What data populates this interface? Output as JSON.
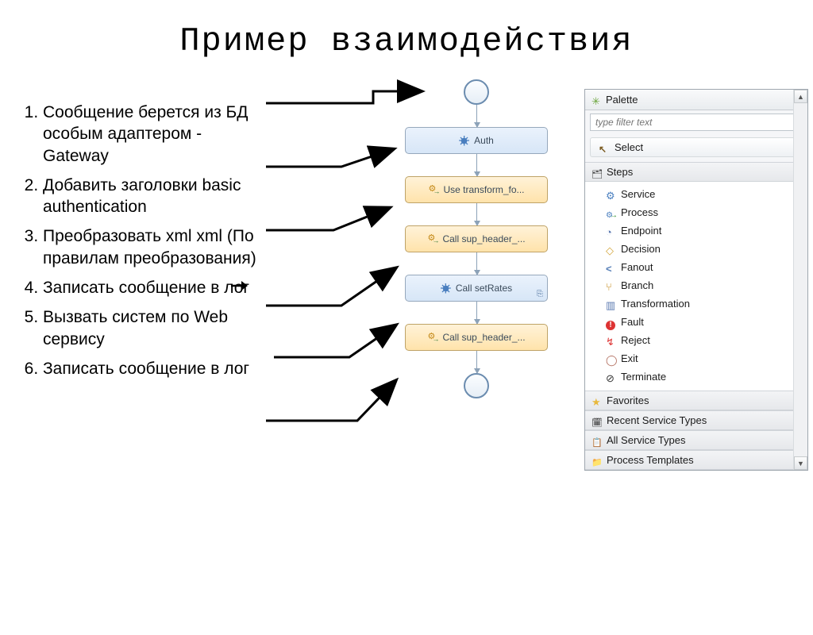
{
  "title": "Пример взаимодействия",
  "list": {
    "items": [
      "Сообщение берется из БД особым адаптером - Gateway",
      "Добавить заголовки basic authentication",
      "Преобразовать xml       xml (По правилам преобразования)",
      "Записать сообщение в лог",
      "Вызвать систем по Web сервису",
      "Записать сообщение в лог"
    ]
  },
  "flow": {
    "nodes": [
      {
        "label": "Auth",
        "icon": "gear",
        "selected": false
      },
      {
        "label": "Use transform_fo...",
        "icon": "pcog",
        "selected": true
      },
      {
        "label": "Call sup_header_...",
        "icon": "pcog",
        "selected": true
      },
      {
        "label": "Call setRates",
        "icon": "gear",
        "selected": false,
        "badge": "📋"
      },
      {
        "label": "Call sup_header_...",
        "icon": "pcog",
        "selected": true
      }
    ]
  },
  "palette": {
    "title": "Palette",
    "filter_placeholder": "type filter text",
    "select_label": "Select",
    "section": "Steps",
    "items": [
      {
        "icon": "ic-service",
        "label": "Service"
      },
      {
        "icon": "ic-process",
        "label": "Process"
      },
      {
        "icon": "ic-endpoint",
        "label": "Endpoint"
      },
      {
        "icon": "ic-decision",
        "label": "Decision"
      },
      {
        "icon": "ic-fanout",
        "label": "Fanout"
      },
      {
        "icon": "ic-branch",
        "label": "Branch"
      },
      {
        "icon": "ic-transform",
        "label": "Transformation"
      },
      {
        "icon": "ic-fault",
        "label": "Fault"
      },
      {
        "icon": "ic-reject",
        "label": "Reject"
      },
      {
        "icon": "ic-exit",
        "label": "Exit"
      },
      {
        "icon": "ic-terminate",
        "label": "Terminate"
      }
    ],
    "footer": [
      {
        "icon": "ic-star",
        "label": "Favorites"
      },
      {
        "icon": "ic-recent",
        "label": "Recent Service Types"
      },
      {
        "icon": "ic-all",
        "label": "All Service Types"
      },
      {
        "icon": "ic-templates",
        "label": "Process Templates"
      }
    ]
  }
}
